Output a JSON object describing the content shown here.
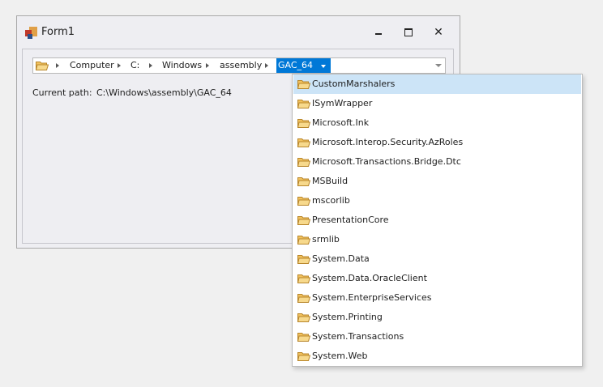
{
  "window": {
    "title": "Form1"
  },
  "breadcrumb": {
    "items": [
      "Computer",
      "C:",
      "Windows",
      "assembly"
    ],
    "selected": "GAC_64"
  },
  "current_path": {
    "label": "Current path:",
    "value": "C:\\Windows\\assembly\\GAC_64"
  },
  "dropdown": {
    "items": [
      "CustomMarshalers",
      "ISymWrapper",
      "Microsoft.Ink",
      "Microsoft.Interop.Security.AzRoles",
      "Microsoft.Transactions.Bridge.Dtc",
      "MSBuild",
      "mscorlib",
      "PresentationCore",
      "srmlib",
      "System.Data",
      "System.Data.OracleClient",
      "System.EnterpriseServices",
      "System.Printing",
      "System.Transactions",
      "System.Web"
    ],
    "highlighted": "CustomMarshalers"
  },
  "colors": {
    "accent": "#0078d7",
    "highlight": "#cce4f7",
    "folder": "#f2c25e"
  },
  "icons": [
    "folder-icon",
    "minimize-icon",
    "maximize-icon",
    "close-icon",
    "chevron-right-icon",
    "chevron-down-icon"
  ]
}
